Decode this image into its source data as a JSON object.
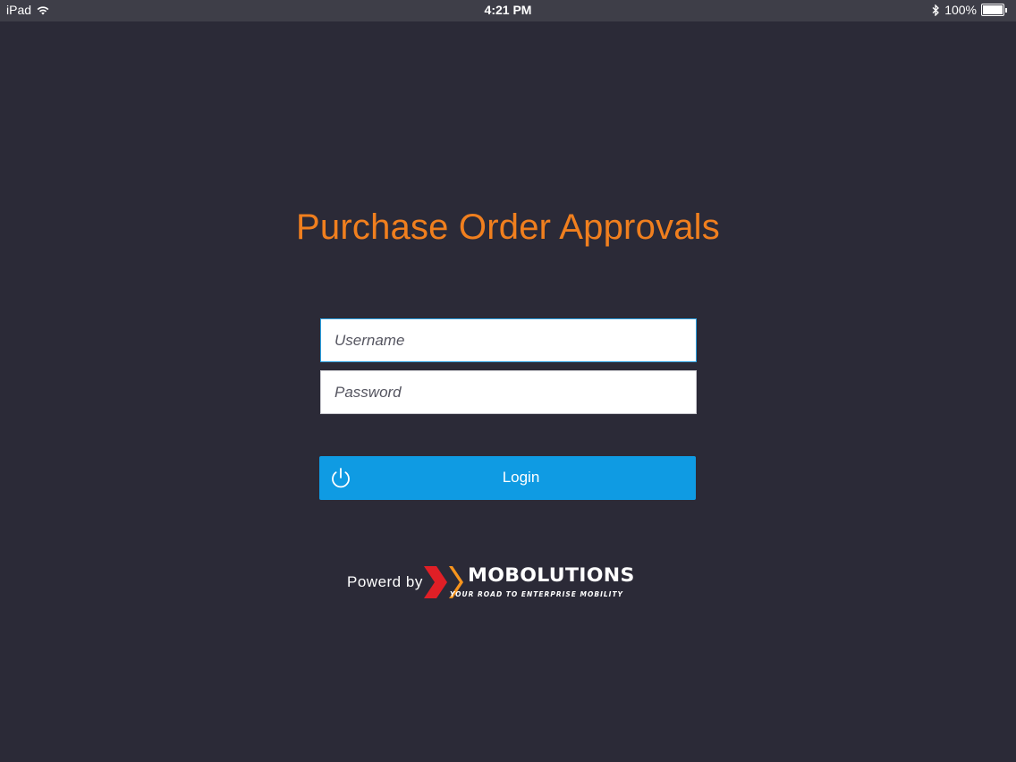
{
  "status_bar": {
    "device": "iPad",
    "time": "4:21 PM",
    "battery_text": "100%",
    "icons": [
      "wifi-icon",
      "bluetooth-icon",
      "battery-icon"
    ]
  },
  "login": {
    "title": "Purchase Order Approvals",
    "username_placeholder": "Username",
    "password_placeholder": "Password",
    "button_label": "Login",
    "button_icon": "power-icon"
  },
  "footer": {
    "powered_text": "Powerd by",
    "brand_name": "MOBOLUTIONS",
    "brand_tagline": "YOUR ROAD TO ENTERPRISE MOBILITY"
  },
  "colors": {
    "background": "#2b2a37",
    "title": "#f07f1e",
    "button": "#0f9be3",
    "logo_orange": "#f7941d",
    "logo_red": "#e01f26"
  }
}
